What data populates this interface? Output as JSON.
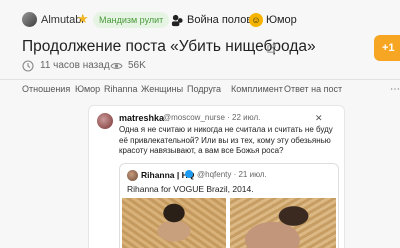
{
  "post": {
    "author": "Almutabi",
    "badge": "Мандизм рулит",
    "community": "Война полов",
    "category": "Юмор",
    "title": "Продолжение поста «Убить нищеброда»",
    "score": "+1",
    "time_ago": "11 часов назад",
    "views": "56K"
  },
  "tags": [
    "Отношения",
    "Юмор",
    "Rihanna",
    "Женщины",
    "Подруга",
    "Комплимент",
    "Ответ на пост"
  ],
  "tags_more": "⋯",
  "tweet": {
    "name": "matreshka",
    "handle": "@moscow_nurse · 22 июл.",
    "close_glyph": "✕",
    "text": "Одна я не считаю и никогда не считала и считать не буду её привлекательной? Или вы из тех, кому эту обезьянью красоту навязывают, а вам все Божья роса?",
    "quote": {
      "name": "Rihanna | HQ",
      "handle": "@hqfenty · 21 июл.",
      "text": "Rihanna for VOGUE Brazil, 2014."
    }
  },
  "icons": {
    "star": "star-icon",
    "community": "community-icon",
    "humor": "humor-icon",
    "share": "share-icon",
    "time": "clock-icon",
    "views": "eye-icon"
  },
  "colors": {
    "accent": "#f6a623",
    "badge_bg": "#e6f4e3",
    "badge_text": "#4a9a3c",
    "verified": "#1d9bf0"
  }
}
